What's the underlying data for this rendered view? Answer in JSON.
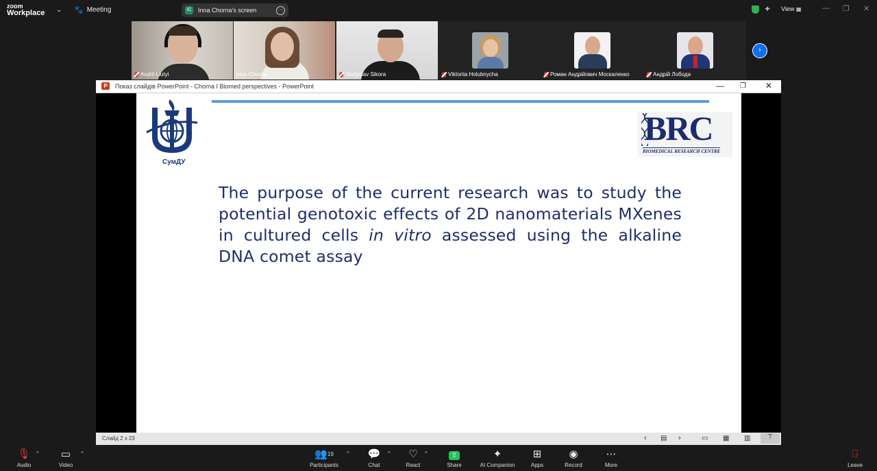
{
  "topbar": {
    "logo_line1": "zoom",
    "logo_line2": "Workplace",
    "meeting_label": "Meeting",
    "screen_share_label": "Inna Chorna's screen",
    "screen_share_initials": "IC",
    "view_label": "View"
  },
  "participants_strip": [
    {
      "name": "Andrii Liutyi",
      "muted": true,
      "type": "video"
    },
    {
      "name": "Inna Chorna",
      "muted": false,
      "type": "video",
      "active_speaker": true
    },
    {
      "name": "Vladyslav Sikora",
      "muted": true,
      "type": "video"
    },
    {
      "name": "Viktoriia Holubnycha",
      "muted": true,
      "type": "photo"
    },
    {
      "name": "Роман Андрійович Москаленко",
      "muted": true,
      "type": "photo"
    },
    {
      "name": "Андрій Лобода",
      "muted": true,
      "type": "photo"
    }
  ],
  "ppt_window": {
    "title": "Показ слайдів PowerPoint  -  Chorna I Biomed perspectives - PowerPoint",
    "slide_counter": "Слайд 2 з 23"
  },
  "slide": {
    "left_logo_text": "СумДУ",
    "right_logo_text": "BRC",
    "right_logo_sub": "BIOMEDICAL RESEARCH CENTRE",
    "body_part1": "The purpose of the  current research was to study the potential genotoxic effects of 2D nanomaterials MXenes in cultured cells ",
    "body_italic": "in vitro",
    "body_part2": " assessed using the alkaline DNA comet assay"
  },
  "toolbar": {
    "audio": "Audio",
    "video": "Video",
    "participants": "Participants",
    "participants_count": "19",
    "chat": "Chat",
    "react": "React",
    "share": "Share",
    "ai_companion": "AI Companion",
    "apps": "Apps",
    "record": "Record",
    "more": "More",
    "leave": "Leave"
  },
  "colors": {
    "slide_text": "#1f2d6a",
    "slide_topline": "#5b9bd5",
    "active_speaker_border": "#3cd36b",
    "share_green": "#23c35c",
    "leave_red": "#e02828"
  }
}
